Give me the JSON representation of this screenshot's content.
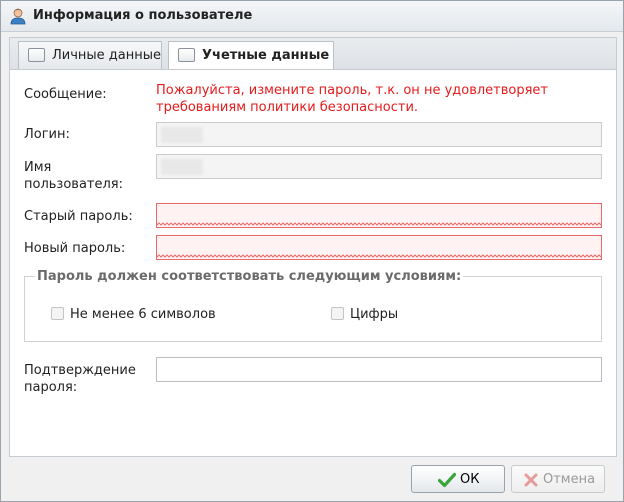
{
  "window": {
    "title": "Информация о пользователе",
    "icon": "user-icon"
  },
  "tabs": [
    {
      "label": "Личные данные",
      "active": false
    },
    {
      "label": "Учетные данные",
      "active": true
    }
  ],
  "form": {
    "message_label": "Сообщение:",
    "message_line1": "Пожалуйста, измените пароль, т.к. он не удовлетворяет",
    "message_line2": "требованиям политики безопасности.",
    "message_color": "#e41b1b",
    "login_label": "Логин:",
    "username_label_line1": "Имя",
    "username_label_line2": "пользователя:",
    "old_password_label": "Старый пароль:",
    "new_password_label": "Новый пароль:",
    "conditions_legend": "Пароль должен соответствовать следующим условиям:",
    "conditions": [
      {
        "label": "Не менее 6 символов",
        "checked": false
      },
      {
        "label": "Цифры",
        "checked": false
      }
    ],
    "confirm_label_line1": "Подтверждение",
    "confirm_label_line2": "пароля:"
  },
  "buttons": {
    "ok_label": "ОК",
    "ok_icon": "checkmark-icon",
    "cancel_label": "Отмена",
    "cancel_icon": "cross-icon",
    "cancel_disabled": true
  },
  "colors": {
    "invalid_border": "#e76a6a",
    "ok_green": "#3aa63a",
    "cancel_red": "#d9534f"
  }
}
